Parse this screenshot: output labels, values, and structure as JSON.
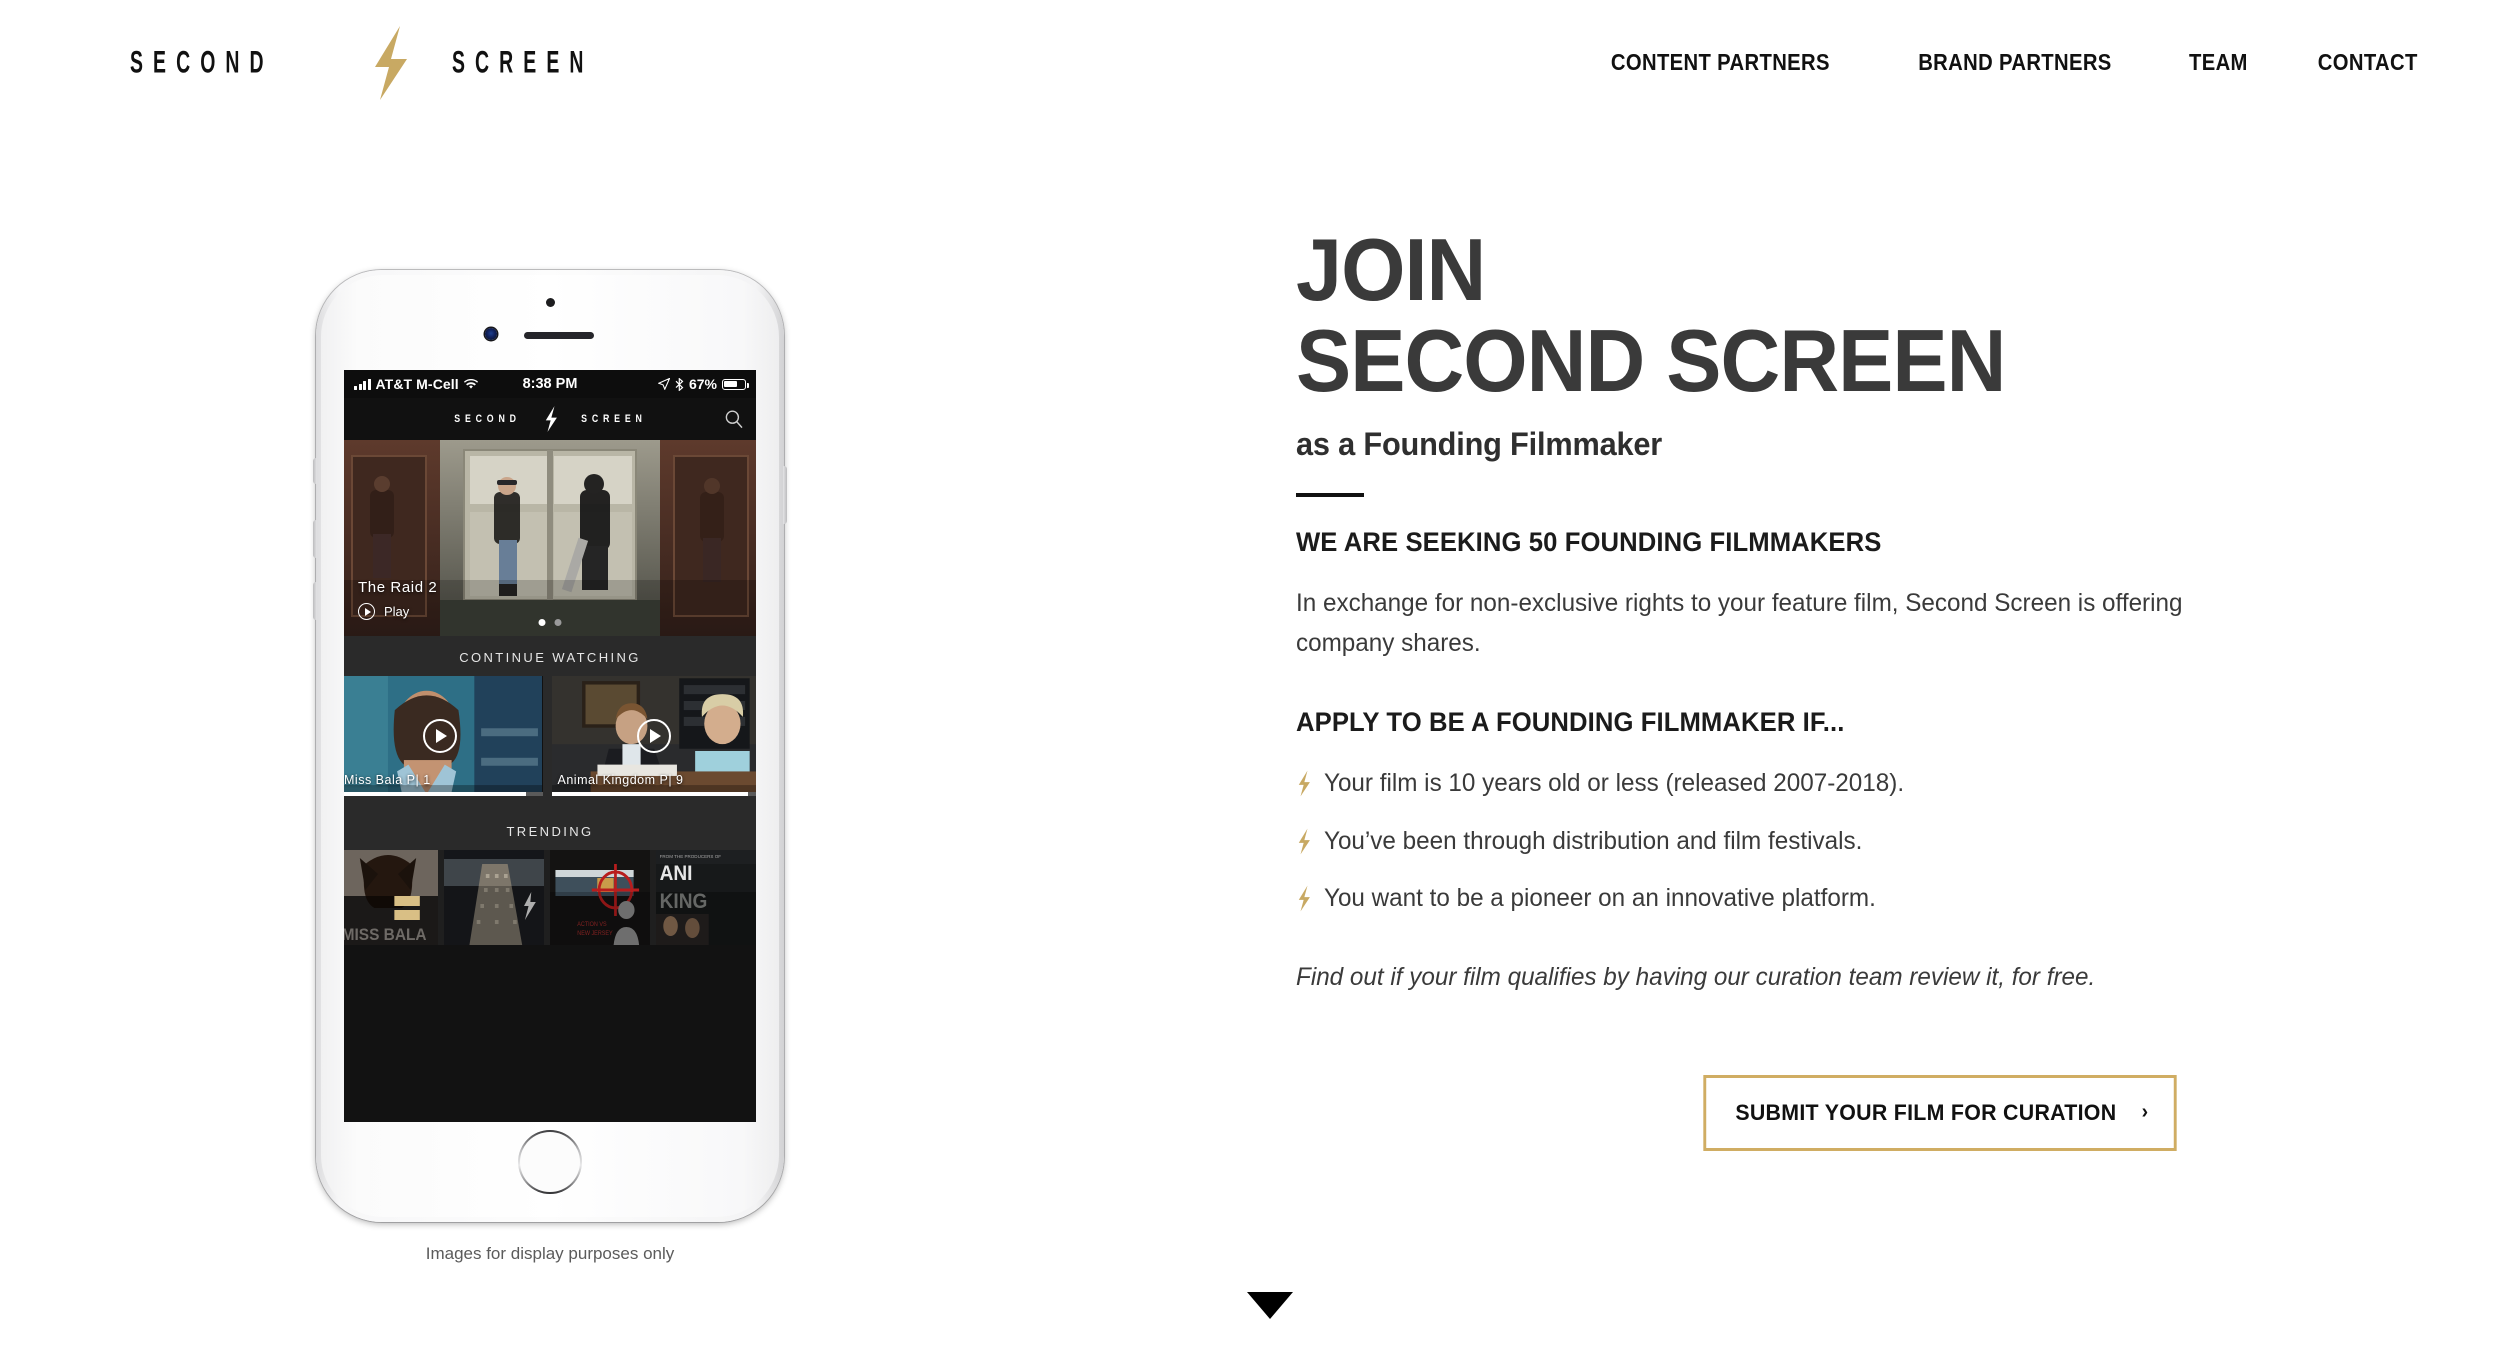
{
  "header": {
    "logo": {
      "left_word": "SECOND",
      "right_word": "SCREEN",
      "bolt_icon": "lightning-bolt-icon",
      "bolt_color": "#c8a963"
    },
    "nav": [
      {
        "label": "CONTENT PARTNERS"
      },
      {
        "label": "BRAND PARTNERS"
      },
      {
        "label": "TEAM"
      },
      {
        "label": "CONTACT"
      }
    ]
  },
  "phone": {
    "statusbar": {
      "signal_icon": "cellular-bars-icon",
      "carrier": "AT&T M-Cell",
      "wifi_icon": "wifi-icon",
      "time": "8:38 PM",
      "location_icon": "location-arrow-icon",
      "bluetooth_icon": "bluetooth-icon",
      "battery_percent": "67%",
      "battery_icon": "battery-icon",
      "battery_level": 67
    },
    "app_header": {
      "logo_left": "SECOND",
      "logo_right": "SCREEN",
      "bolt_icon": "lightning-bolt-icon",
      "search_icon": "search-icon"
    },
    "hero": {
      "title": "The Raid 2",
      "play_label": "Play",
      "play_icon": "play-circle-icon",
      "dots": [
        {
          "active": true
        },
        {
          "active": false
        }
      ]
    },
    "continue_watching": {
      "section_title": "CONTINUE WATCHING",
      "cards": [
        {
          "label": "Miss Bala P| 1",
          "play_icon": "play-circle-icon",
          "progress": 92
        },
        {
          "label": "Animal Kingdom P| 9",
          "play_icon": "play-circle-icon",
          "progress": 96
        }
      ]
    },
    "trending": {
      "section_title": "TRENDING",
      "cards": [
        {
          "label": "MISS BALA"
        },
        {
          "label": ""
        },
        {
          "label": ""
        },
        {
          "label": "ANIMAL KINGDOM"
        }
      ]
    },
    "caption": "Images for display purposes only"
  },
  "main": {
    "heading_line1": "JOIN",
    "heading_line2": "SECOND SCREEN",
    "subheading": "as a Founding Filmmaker",
    "section1_title": "WE ARE SEEKING 50 FOUNDING FILMMAKERS",
    "section1_body": "In exchange for non-exclusive rights to your feature film, Second Screen is offering company shares.",
    "section2_title": "APPLY TO BE A FOUNDING FILMMAKER IF...",
    "bullets": [
      {
        "text": "Your film is 10 years old or less (released 2007-2018).",
        "icon": "lightning-bolt-icon"
      },
      {
        "text": "You’ve been through distribution and film festivals.",
        "icon": "lightning-bolt-icon"
      },
      {
        "text": "You want to be a pioneer on an innovative platform.",
        "icon": "lightning-bolt-icon"
      }
    ],
    "italic_note": "Find out if your film qualifies by having our curation team review it, for free.",
    "cta": {
      "label": "SUBMIT YOUR FILM FOR CURATION",
      "chevron": "›",
      "border_color": "#d0ad63"
    },
    "scroll_arrow_icon": "scroll-down-arrow-icon"
  },
  "colors": {
    "gold": "#c8a963",
    "cta_gold": "#d0ad63",
    "heading_gray": "#3a3a3a",
    "black": "#111111",
    "app_bg": "#121212"
  }
}
